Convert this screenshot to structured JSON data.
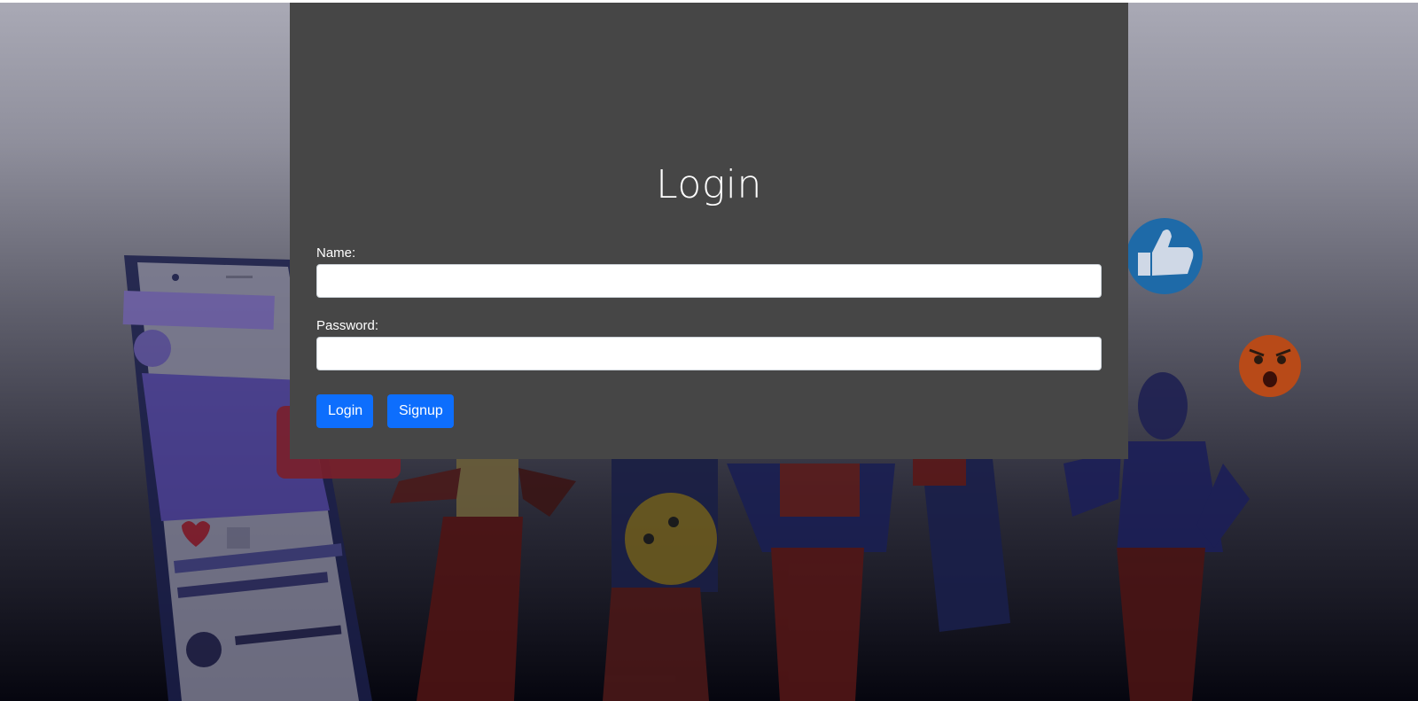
{
  "form": {
    "title": "Login",
    "name_label": "Name:",
    "name_value": "",
    "password_label": "Password:",
    "password_value": "",
    "login_button": "Login",
    "signup_button": "Signup"
  },
  "colors": {
    "card_background": "#464646",
    "button_primary": "#0d6efd",
    "text": "#ffffff"
  },
  "background": {
    "icons": [
      "phone-illustration",
      "thumbs-up-icon",
      "angry-emoji-icon",
      "smiley-emoji-icon",
      "heart-icon",
      "people-illustration"
    ]
  }
}
